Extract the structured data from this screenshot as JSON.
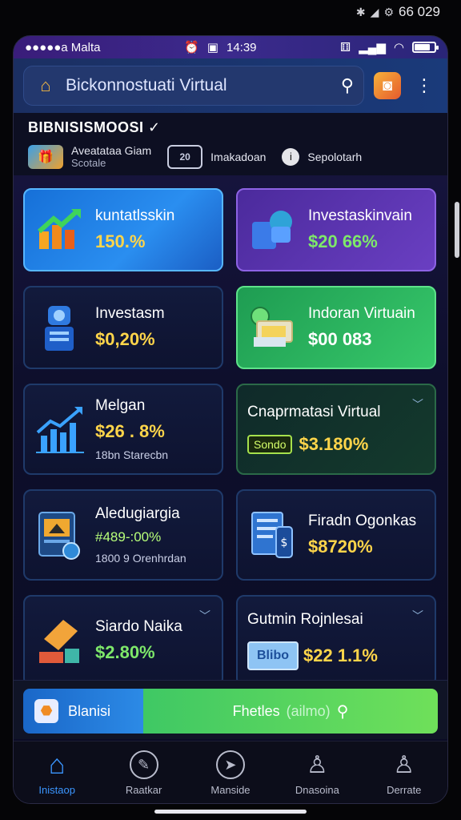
{
  "outer_status": {
    "icons": [
      "bluetooth-icon",
      "signal-icon",
      "gear-icon"
    ],
    "time": "66 029"
  },
  "status_bar": {
    "carrier": "●●●●●a Malta",
    "time": "14:39",
    "battery_fill": 0.8
  },
  "header": {
    "logo_icon": "house-chart-icon",
    "search_value": "Bickonnostuati Virtual",
    "search_placeholder": "Bickonnostuati Virtual",
    "camera_icon": "camera-icon",
    "menu_icon": "menu-icon"
  },
  "section": {
    "title": "BIBNISISMOOSI ✓",
    "filters": [
      {
        "label": "Aveatataa Giam",
        "sub": "Scotale",
        "icon": "gift-icon"
      },
      {
        "label": "Imakadoan",
        "sub": "",
        "icon": "box-icon",
        "icon_text": "20"
      },
      {
        "label": "Sepolotarh",
        "sub": "",
        "icon": "info-icon"
      }
    ]
  },
  "cards": [
    {
      "name": "kuntatlsskin",
      "value": "150.%",
      "sub": "",
      "style": "blue",
      "value_color": "yellow",
      "icon": "chart-up-icon"
    },
    {
      "name": "Investaskinvain",
      "value": "$20 66%",
      "sub": "",
      "style": "purple",
      "value_color": "green",
      "icon": "cube-icon"
    },
    {
      "name": "Investasm",
      "value": "$0,20%",
      "sub": "",
      "style": "dark",
      "value_color": "yellow",
      "icon": "robot-icon"
    },
    {
      "name": "Indoran Virtuain",
      "value": "$00 083",
      "sub": "",
      "style": "green",
      "value_color": "white",
      "icon": "money-stack-icon"
    },
    {
      "name": "Melgan",
      "value": "$26 . 8%",
      "sub": "18bn Starecbn",
      "style": "dark",
      "value_color": "yellow",
      "icon": "bar-chart-icon"
    },
    {
      "name": "Cnaprmatasi Virtual",
      "value": "$3.180%",
      "sub": "",
      "chip": "Sondo",
      "style": "darkgreen",
      "value_color": "yellow",
      "icon": "",
      "chevron": "chevron-down-icon"
    },
    {
      "name": "Aledugiargia",
      "value": "#489-:00%",
      "sub": "1800 9 Orenhrdan",
      "style": "dark",
      "value_color": "lime",
      "icon": "tablet-icon"
    },
    {
      "name": "Firadn Ogonkas",
      "value": "$8720%",
      "sub": "",
      "style": "dark",
      "value_color": "yellow",
      "icon": "document-phone-icon"
    },
    {
      "name": "Siardo Naika",
      "value": "$2.80%",
      "sub": "",
      "style": "dark",
      "value_color": "green",
      "icon": "folder-icon",
      "chevron": "chevron-down-icon"
    },
    {
      "name": "Gutmin Rojnlesai",
      "value": "$22 1.1%",
      "sub": "",
      "style": "dark",
      "value_color": "yellow",
      "icon": "card-icon",
      "icon_text": "Blibo",
      "chevron": "chevron-down-icon"
    }
  ],
  "bottom_search": {
    "left_label": "Blanisi",
    "right_label": "Fhetles",
    "right_hint": "(ailmo)",
    "pin_icon": "map-pin-icon",
    "search_icon": "search-icon"
  },
  "tabbar": [
    {
      "label": "Inistaop",
      "icon": "home-icon",
      "active": true
    },
    {
      "label": "Raatkar",
      "icon": "chat-icon",
      "active": false
    },
    {
      "label": "Manside",
      "icon": "compass-icon",
      "active": false
    },
    {
      "label": "Dnasoina",
      "icon": "person-icon",
      "active": false
    },
    {
      "label": "Derrate",
      "icon": "person-icon",
      "active": false
    }
  ]
}
